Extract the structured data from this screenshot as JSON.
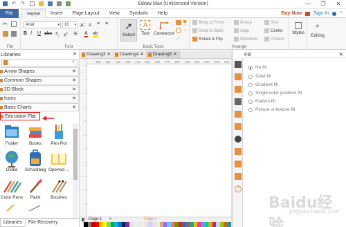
{
  "window": {
    "title": "Edraw Max (Unlicensed Version)",
    "controls": [
      "—",
      "❐",
      "✕"
    ]
  },
  "menu": {
    "file": "File",
    "items": [
      "Home",
      "Insert",
      "Page Layout",
      "View",
      "Symbols",
      "Help"
    ],
    "buy_now": "Buy Now",
    "sign_in": "Sign In"
  },
  "ribbon": {
    "file_group": "File",
    "font_group": "Font",
    "font_name": "Arial",
    "font_size": "10",
    "basic_tools_group": "Basic Tools",
    "select": "Select",
    "text": "Text",
    "connector": "Connector",
    "arrange_group": "Arrange",
    "bring_to_front": "Bring to Front",
    "send_to_back": "Send to Back",
    "rotate_flip": "Rotate & Flip",
    "group": "Group",
    "align": "Align",
    "distribute": "Distribute",
    "size": "Size",
    "center": "Center",
    "protect": "Protect",
    "styles": "Styles",
    "editing": "Editing"
  },
  "libraries": {
    "title": "Libraries",
    "categories": [
      "Arrow Shapes",
      "Common Shapes",
      "2D Block",
      "Icons",
      "Basic Charts"
    ],
    "highlighted": "Education Flat",
    "shapes": [
      "Folder",
      "Books",
      "Pen Pot",
      "Globe",
      "Schoolbag",
      "Opened ...",
      "Color Pens",
      "Paint",
      "Brushes"
    ],
    "tabs": [
      "Libraries",
      "File Recovery"
    ]
  },
  "documents": {
    "tabs": [
      "Drawing3",
      "Drawing4",
      "Drawing5"
    ],
    "active": "Drawing5"
  },
  "ruler_marks": [
    "100",
    "110",
    "120",
    "130",
    "140",
    "150",
    "160",
    "170",
    "180",
    "190",
    "200",
    "210",
    "220",
    "230"
  ],
  "pages": {
    "current": "Page-1",
    "tab": "Page-1"
  },
  "fill": {
    "title": "Fill",
    "options": [
      "No fill",
      "Solid fill",
      "Gradient fill",
      "Single color gradient fill",
      "Pattern fill",
      "Picture or texture fill"
    ],
    "selected": "No fill"
  },
  "colors": [
    "#ffffff",
    "#000000",
    "#7f7f7f",
    "#c00000",
    "#ff0000",
    "#ffc000",
    "#ffff00",
    "#92d050",
    "#00b050",
    "#00b0f0",
    "#0070c0",
    "#002060",
    "#7030a0",
    "#f2dcdb",
    "#ebf1dd",
    "#dbeef3",
    "#fde9d9",
    "#e5e0ec",
    "#c6d9f0",
    "#ffccff",
    "#ccffcc",
    "#ff9966",
    "#9966ff",
    "#66ccff",
    "#ff6699",
    "#669900",
    "#cc3300",
    "#3366cc",
    "#996633",
    "#339999",
    "#cccc00",
    "#ff3399",
    "#6699ff",
    "#00cc99",
    "#ff9900",
    "#993399",
    "#ccccff",
    "#99cc00",
    "#cc6600",
    "#0099cc"
  ],
  "watermark": {
    "main": "Baidu经验",
    "sub": "jingyan.baidu.com"
  }
}
